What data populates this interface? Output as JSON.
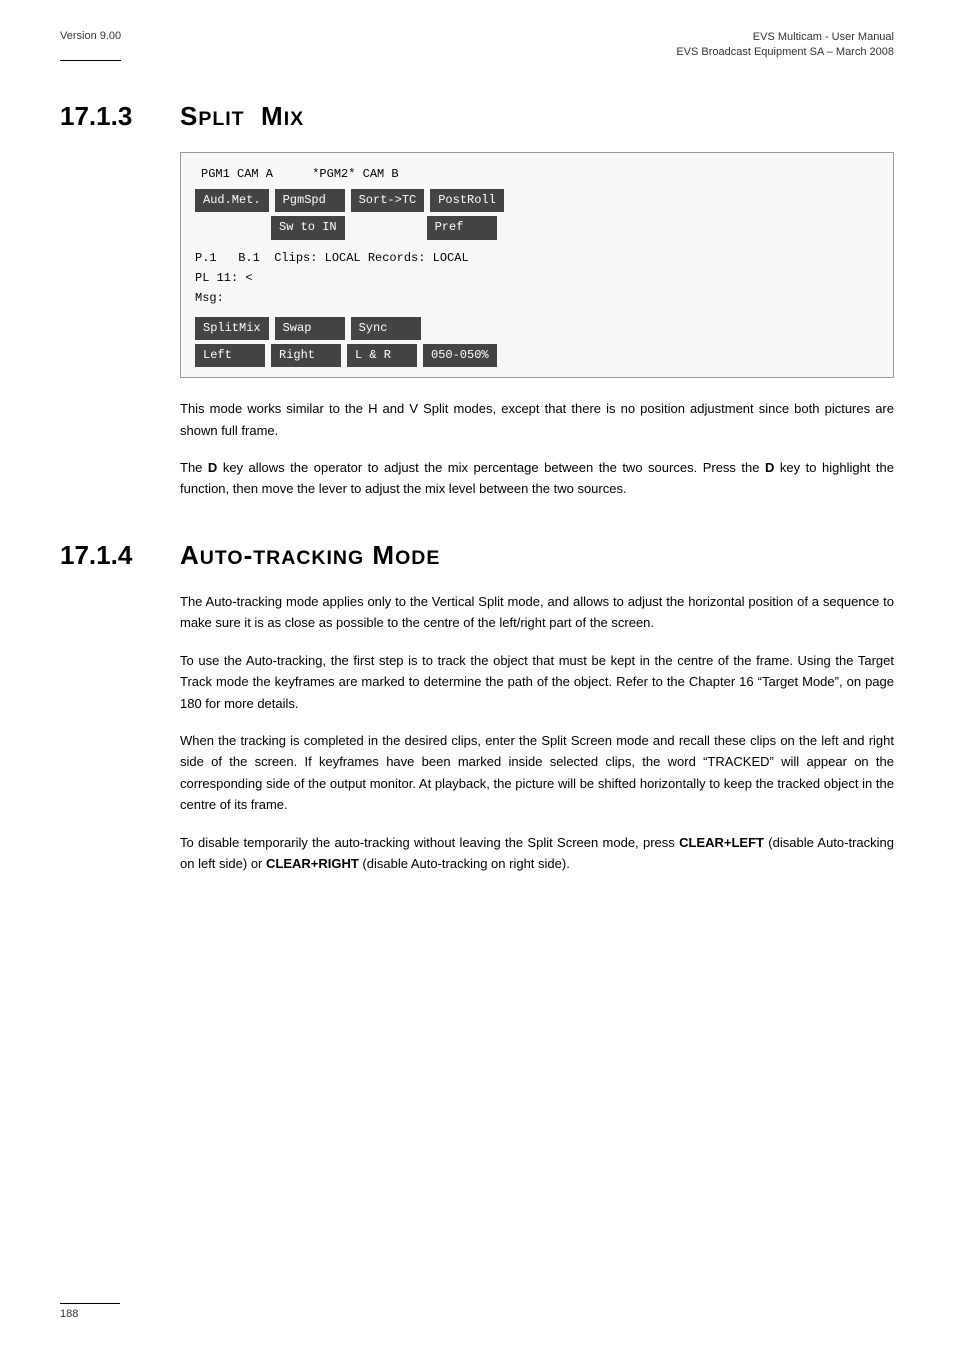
{
  "header": {
    "version": "Version 9.00",
    "title_line1": "EVS Multicam - User Manual",
    "title_line2": "EVS Broadcast Equipment SA – March 2008"
  },
  "section_17_1_3": {
    "number": "17.1.3",
    "title_small": "Split",
    "title_normal": "Mix",
    "terminal": {
      "header_left": "PGM1 CAM A",
      "header_center": "*PGM2* CAM B",
      "row1": [
        "Aud.Met.",
        "PgmSpd",
        "Sort->TC",
        "PostRoll"
      ],
      "row2": [
        "",
        "Sw to IN",
        "",
        "Pref"
      ],
      "info_line1": "P.1   B.1  Clips: LOCAL Records: LOCAL",
      "info_line2": "PL 11: <",
      "info_line3": "Msg:",
      "buttons_row1": [
        "SplitMix",
        "Swap",
        "Sync",
        ""
      ],
      "buttons_row2": [
        "Left",
        "Right",
        "L & R",
        "050-050%"
      ]
    },
    "para1": "This mode works similar to the H and V Split modes, except that there is no position adjustment since both pictures are shown full frame.",
    "para2_prefix": "The ",
    "para2_key": "D",
    "para2_middle": " key allows the operator to adjust the mix percentage between the two sources. Press the ",
    "para2_key2": "D",
    "para2_suffix": " key to highlight the function, then move the lever to adjust the mix level between the two sources."
  },
  "section_17_1_4": {
    "number": "17.1.4",
    "title": "Auto-tracking Mode",
    "para1": "The Auto-tracking mode applies only to the Vertical Split mode, and allows to adjust the horizontal position of a sequence to make sure it is as close as possible to the centre of the left/right part of the screen.",
    "para2": "To use the Auto-tracking, the first step is to track the object that must be kept in the centre of the frame. Using the Target Track mode the keyframes are marked to determine the path of the object. Refer to the Chapter 16 “Target Mode”, on page 180 for more details.",
    "para3": "When the tracking is completed in the desired clips, enter the Split Screen mode and recall these clips on the left and right side of the screen. If keyframes have been marked inside selected clips, the word “TRACKED” will appear on the corresponding side of the output monitor. At playback, the picture will be shifted horizontally to keep the tracked object in the centre of its frame.",
    "para4_prefix": "To disable temporarily the auto-tracking without leaving the Split Screen mode, press ",
    "para4_key1": "CLEAR+LEFT",
    "para4_middle": " (disable Auto-tracking on left side) or ",
    "para4_key2": "CLEAR+RIGHT",
    "para4_suffix": " (disable Auto-tracking on right side)."
  },
  "footer": {
    "page_number": "188"
  }
}
